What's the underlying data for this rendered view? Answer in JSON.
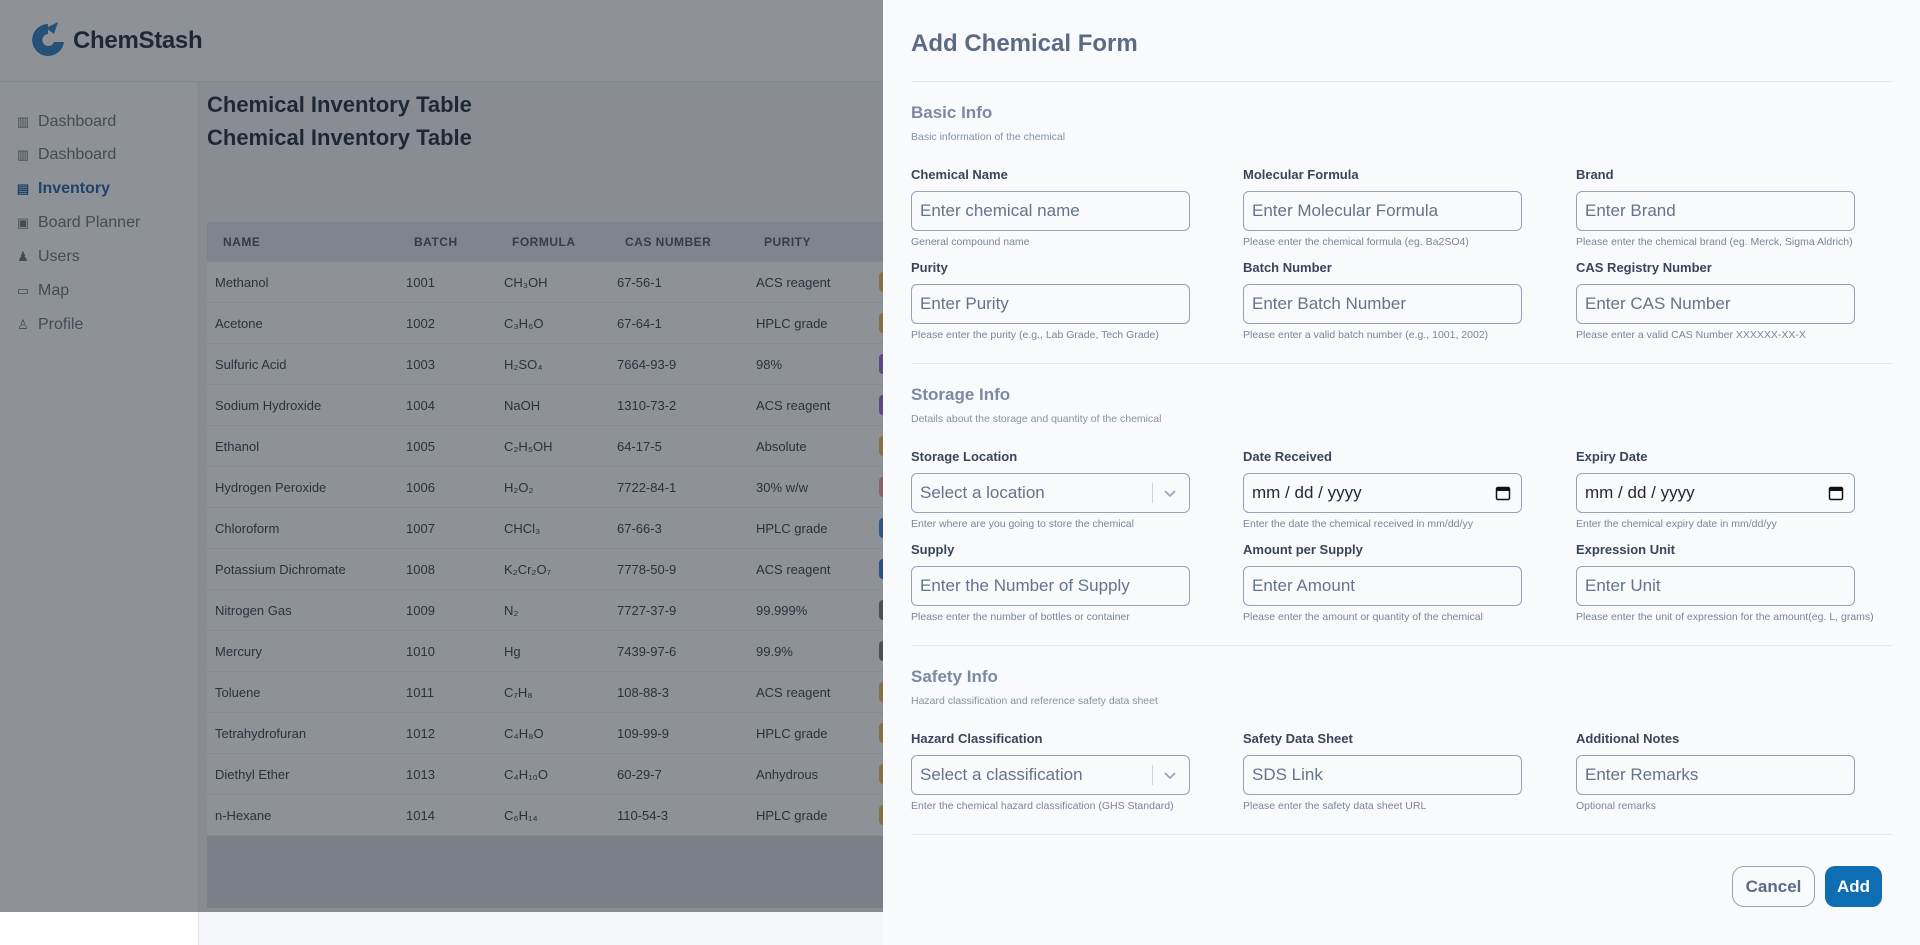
{
  "app": {
    "brand": "ChemStash",
    "nav": [
      {
        "label": "Dashboard",
        "icon": "chart-icon"
      },
      {
        "label": "Dashboard",
        "icon": "chart-icon"
      },
      {
        "label": "Inventory",
        "icon": "inventory-icon",
        "active": true
      },
      {
        "label": "Board Planner",
        "icon": "board-icon"
      },
      {
        "label": "Users",
        "icon": "users-icon"
      },
      {
        "label": "Map",
        "icon": "map-icon"
      },
      {
        "label": "Profile",
        "icon": "profile-icon"
      }
    ],
    "page_titles": [
      "Chemical Inventory Table",
      "Chemical Inventory Table"
    ],
    "table": {
      "headers": [
        "NAME",
        "BATCH",
        "FORMULA",
        "CAS NUMBER",
        "PURITY"
      ],
      "rows": [
        {
          "name": "Methanol",
          "batch": "1001",
          "formula": "CH₃OH",
          "cas": "67-56-1",
          "purity": "ACS reagent",
          "tag_color": "#e8c15a"
        },
        {
          "name": "Acetone",
          "batch": "1002",
          "formula": "C₃H₆O",
          "cas": "67-64-1",
          "purity": "HPLC grade",
          "tag_color": "#e8c15a"
        },
        {
          "name": "Sulfuric Acid",
          "batch": "1003",
          "formula": "H₂SO₄",
          "cas": "7664-93-9",
          "purity": "98%",
          "tag_color": "#9b6bd6"
        },
        {
          "name": "Sodium Hydroxide",
          "batch": "1004",
          "formula": "NaOH",
          "cas": "1310-73-2",
          "purity": "ACS reagent",
          "tag_color": "#9b6bd6"
        },
        {
          "name": "Ethanol",
          "batch": "1005",
          "formula": "C₂H₅OH",
          "cas": "64-17-5",
          "purity": "Absolute",
          "tag_color": "#e8c15a"
        },
        {
          "name": "Hydrogen Peroxide",
          "batch": "1006",
          "formula": "H₂O₂",
          "cas": "7722-84-1",
          "purity": "30% w/w",
          "tag_color": "#f0a0a0"
        },
        {
          "name": "Chloroform",
          "batch": "1007",
          "formula": "CHCl₃",
          "cas": "67-66-3",
          "purity": "HPLC grade",
          "tag_color": "#3b8fd6"
        },
        {
          "name": "Potassium Dichromate",
          "batch": "1008",
          "formula": "K₂Cr₂O₇",
          "cas": "7778-50-9",
          "purity": "ACS reagent",
          "tag_color": "#3b7be0"
        },
        {
          "name": "Nitrogen Gas",
          "batch": "1009",
          "formula": "N₂",
          "cas": "7727-37-9",
          "purity": "99.999%",
          "tag_color": "#7a7a7a"
        },
        {
          "name": "Mercury",
          "batch": "1010",
          "formula": "Hg",
          "cas": "7439-97-6",
          "purity": "99.9%",
          "tag_color": "#7a7a7a"
        },
        {
          "name": "Toluene",
          "batch": "1011",
          "formula": "C₇H₈",
          "cas": "108-88-3",
          "purity": "ACS reagent",
          "tag_color": "#e8c15a"
        },
        {
          "name": "Tetrahydrofuran",
          "batch": "1012",
          "formula": "C₄H₈O",
          "cas": "109-99-9",
          "purity": "HPLC grade",
          "tag_color": "#e8c15a"
        },
        {
          "name": "Diethyl Ether",
          "batch": "1013",
          "formula": "C₄H₁₀O",
          "cas": "60-29-7",
          "purity": "Anhydrous",
          "tag_color": "#e8c15a"
        },
        {
          "name": "n-Hexane",
          "batch": "1014",
          "formula": "C₆H₁₄",
          "cas": "110-54-3",
          "purity": "HPLC grade",
          "tag_color": "#e8c15a"
        }
      ]
    }
  },
  "form": {
    "title": "Add Chemical Form",
    "sections": {
      "basic": {
        "title": "Basic Info",
        "desc": "Basic information of the chemical",
        "fields": {
          "chemical_name": {
            "label": "Chemical Name",
            "placeholder": "Enter chemical name",
            "help": "General compound name"
          },
          "molecular_formula": {
            "label": "Molecular Formula",
            "placeholder": "Enter Molecular Formula",
            "help": "Please enter the chemical formula (eg. Ba2SO4)"
          },
          "brand": {
            "label": "Brand",
            "placeholder": "Enter Brand",
            "help": "Please enter the chemical brand (eg. Merck, Sigma Aldrich)"
          },
          "purity": {
            "label": "Purity",
            "placeholder": "Enter Purity",
            "help": "Please enter the purity (e.g., Lab Grade, Tech Grade)"
          },
          "batch_number": {
            "label": "Batch Number",
            "placeholder": "Enter Batch Number",
            "help": "Please enter a valid batch number (e.g., 1001, 2002)"
          },
          "cas_number": {
            "label": "CAS Registry Number",
            "placeholder": "Enter CAS Number",
            "help": "Please enter a valid CAS Number XXXXXX-XX-X"
          }
        }
      },
      "storage": {
        "title": "Storage Info",
        "desc": "Details about the storage and quantity of the chemical",
        "fields": {
          "storage_location": {
            "label": "Storage Location",
            "placeholder": "Select a location",
            "help": "Enter where are you going to store the chemical"
          },
          "date_received": {
            "label": "Date Received",
            "value": "mm / dd / yyyy",
            "help": "Enter the date the chemical received in mm/dd/yy"
          },
          "expiry_date": {
            "label": "Expiry Date",
            "value": "mm / dd / yyyy",
            "help": "Enter the chemical expiry date in mm/dd/yy"
          },
          "supply": {
            "label": "Supply",
            "placeholder": "Enter the Number of Supply",
            "help": "Please enter the number of bottles or container"
          },
          "amount_per_supply": {
            "label": "Amount per Supply",
            "placeholder": "Enter Amount",
            "help": "Please enter the amount or quantity of the chemical"
          },
          "expression_unit": {
            "label": "Expression Unit",
            "placeholder": "Enter Unit",
            "help": "Please enter the unit of expression for the amount(eg. L, grams)"
          }
        }
      },
      "safety": {
        "title": "Safety Info",
        "desc": "Hazard classification and reference safety data sheet",
        "fields": {
          "hazard": {
            "label": "Hazard Classification",
            "placeholder": "Select a classification",
            "help": "Enter the chemical hazard classification (GHS Standard)"
          },
          "sds": {
            "label": "Safety Data Sheet",
            "placeholder": "SDS Link",
            "help": "Please enter the safety data sheet URL"
          },
          "notes": {
            "label": "Additional Notes",
            "placeholder": "Enter Remarks",
            "help": "Optional remarks"
          }
        }
      }
    },
    "buttons": {
      "cancel": "Cancel",
      "add": "Add"
    }
  },
  "colors": {
    "primary": "#0f6db3",
    "overlay": "rgba(30,36,46,0.5)",
    "brand_logo": "#2e7fc0"
  }
}
